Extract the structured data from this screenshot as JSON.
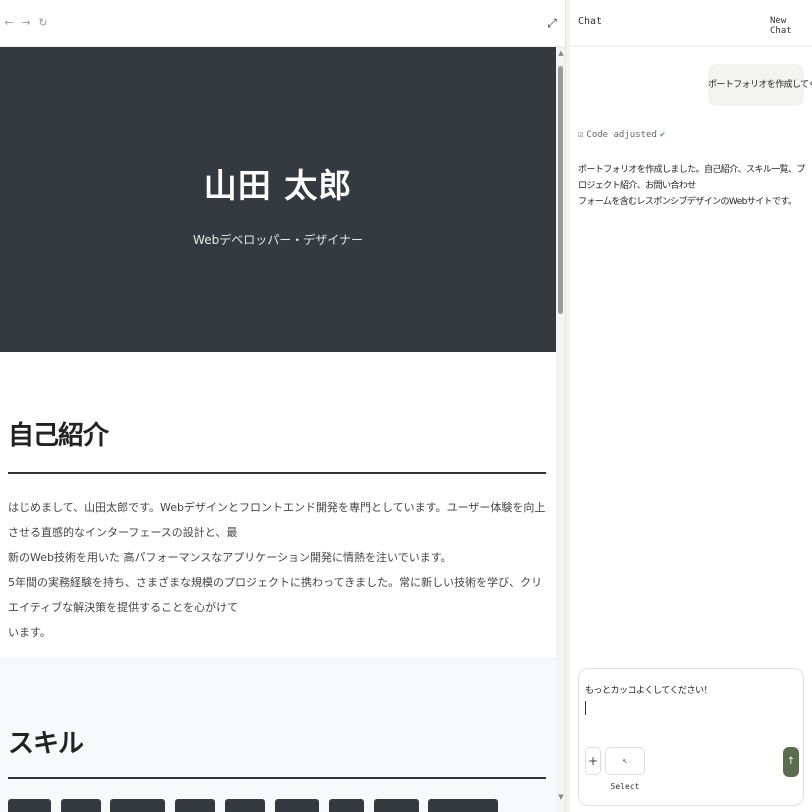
{
  "browser": {
    "back_icon": "←",
    "forward_icon": "→",
    "reload_icon": "↻",
    "expand_icon": "⤢"
  },
  "site": {
    "hero": {
      "name": "山田 太郎",
      "subtitle": "Webデベロッパー・デザイナー"
    },
    "about": {
      "heading": "自己紹介",
      "paragraph1_line1": "はじめまして、山田太郎です。Webデザインとフロントエンド開発を専門としています。ユーザー体験を向上させる直感的なインターフェースの設計と、最",
      "paragraph1_line2": "新のWeb技術を用いた 高パフォーマンスなアプリケーション開発に情熱を注いでいます。",
      "paragraph2_line1": "5年間の実務経験を持ち、さまざまな規模のプロジェクトに携わってきました。常に新しい技術を学び、クリエイティブな解決策を提供することを心がけて",
      "paragraph2_line2": "います。"
    },
    "skills": {
      "heading": "スキル",
      "tag_count": 9
    }
  },
  "chat": {
    "title": "Chat",
    "new_chat": "New Chat",
    "user_message": "ポートフォリオを作成してください。",
    "status": "Code adjusted",
    "status_icon": "☑",
    "check_icon": "✔",
    "assistant_line1": "ポートフォリオを作成しました。自己紹介、スキル一覧、プロジェクト紹介、お問い合わせ",
    "assistant_line2": "フォームを含むレスポンシブデザインのWebサイトです。",
    "input_value": "もっとカッコよくしてください！",
    "plus_label": "+",
    "select_label": "Select",
    "select_icon": "↖",
    "send_icon": "↑"
  },
  "colors": {
    "hero_bg": "#343a40",
    "send_button": "#5b6b4e",
    "skills_bg": "#f8f9fa"
  }
}
